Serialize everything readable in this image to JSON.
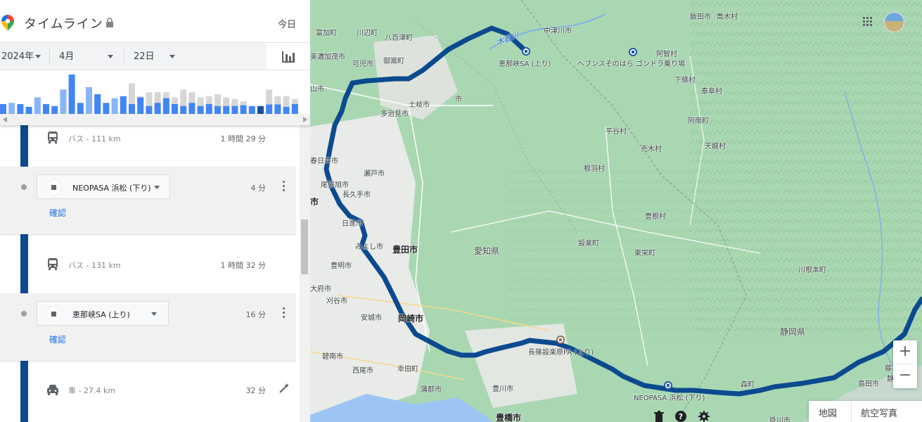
{
  "header": {
    "title": "タイムライン",
    "today_label": "今日"
  },
  "date": {
    "year": "2024年",
    "month": "4月",
    "day": "22日"
  },
  "histogram": {
    "values": [
      0.25,
      0.28,
      0.25,
      0.18,
      0.42,
      0.25,
      0.2,
      0.62,
      1.0,
      0.28,
      0.68,
      0.5,
      0.28,
      0.4,
      0.45,
      0.25,
      0.42,
      0.2,
      0.28,
      0.4,
      0.25,
      0.2,
      0.28,
      0.2,
      0.25,
      0.2,
      0.2,
      0.2,
      0.22,
      0.2,
      0.2,
      0.24,
      0.24,
      0.18,
      0.25,
      0.18
    ],
    "ghost": [
      0,
      0,
      0,
      0,
      0,
      0,
      0,
      0,
      0,
      0,
      0,
      0,
      0,
      0,
      0,
      0.78,
      0.45,
      0.55,
      0.55,
      0.55,
      0.42,
      0.62,
      0.55,
      0.42,
      0.45,
      0.5,
      0.42,
      0.38,
      0.32,
      0.0,
      0.0,
      0.62,
      0.45,
      0.45,
      0.38,
      0.32
    ],
    "dark_index": 30
  },
  "timeline": {
    "moves": [
      {
        "mode": "bus-icon",
        "label": "バス - 111 km",
        "duration": "1 時間 29 分"
      },
      {
        "mode": "bus-icon",
        "label": "バス - 131 km",
        "duration": "1 時間 32 分"
      },
      {
        "mode": "car-icon",
        "label": "車 - 27.4 km",
        "duration": "32 分"
      }
    ],
    "stops": [
      {
        "name": "NEOPASA 浜松 (下り)",
        "duration": "4 分",
        "confirm": "確認"
      },
      {
        "name": "恵那峡SA (上り)",
        "duration": "16 分",
        "confirm": "確認"
      }
    ]
  },
  "map": {
    "labels": {
      "tomika": "富加町",
      "kawabe": "川辺町",
      "yaotsu": "八百津町",
      "nakatsugawa": "中津川市",
      "iida": "飯田市",
      "takamori": "喬木村",
      "minokamo": "美濃加茂市",
      "kani": "可児市",
      "mitake": "御嵩町",
      "enakyo_sa": "恵那峡SA (上り)",
      "heavens": "ヘブンスそのはら ゴンドラ乗り場",
      "achi": "阿智村",
      "shimojo": "下條村",
      "yasuoka": "泰阜村",
      "anan": "阿南町",
      "tenryu": "天龍村",
      "hiraya": "平谷村",
      "urugi": "売木村",
      "neba": "根羽村",
      "toyone": "豊根村",
      "shitara": "設楽町",
      "toei": "東栄町",
      "aichi": "愛知県",
      "shizuoka": "静岡県",
      "kawanehon": "川根本町",
      "tajimi": "多治見市",
      "toki": "土岐市",
      "ena_tail": "市",
      "kasugai": "春日井市",
      "seto": "瀬戸市",
      "owariasahi": "尾張旭市",
      "nagakute": "長久手市",
      "nisshin": "日進市",
      "miyoshi": "みよし市",
      "toyota": "豊田市",
      "toyoake": "豊明市",
      "obu": "大府市",
      "kariya": "刈谷市",
      "anjo": "安城市",
      "okazaki": "岡崎市",
      "hekinan": "碧南市",
      "nishio": "西尾市",
      "kota": "幸田町",
      "gamagori": "蒲郡市",
      "toyokawa": "豊川市",
      "toyohashi": "豊橋市",
      "nagashino_pa": "長篠設楽原PA (上り)",
      "neopasa": "NEOPASA 浜松 (下り)",
      "mori": "森町",
      "shimada": "島田市",
      "kakegawa": "掛川市",
      "kisogawa": "木曽川",
      "yama_city": "山市",
      "ichi_left": "市",
      "fuji_small": "藤",
      "jisuke": "静"
    },
    "map_type": {
      "map": "地図",
      "aerial": "航空写真"
    },
    "route_color": "#0b4a8f"
  }
}
